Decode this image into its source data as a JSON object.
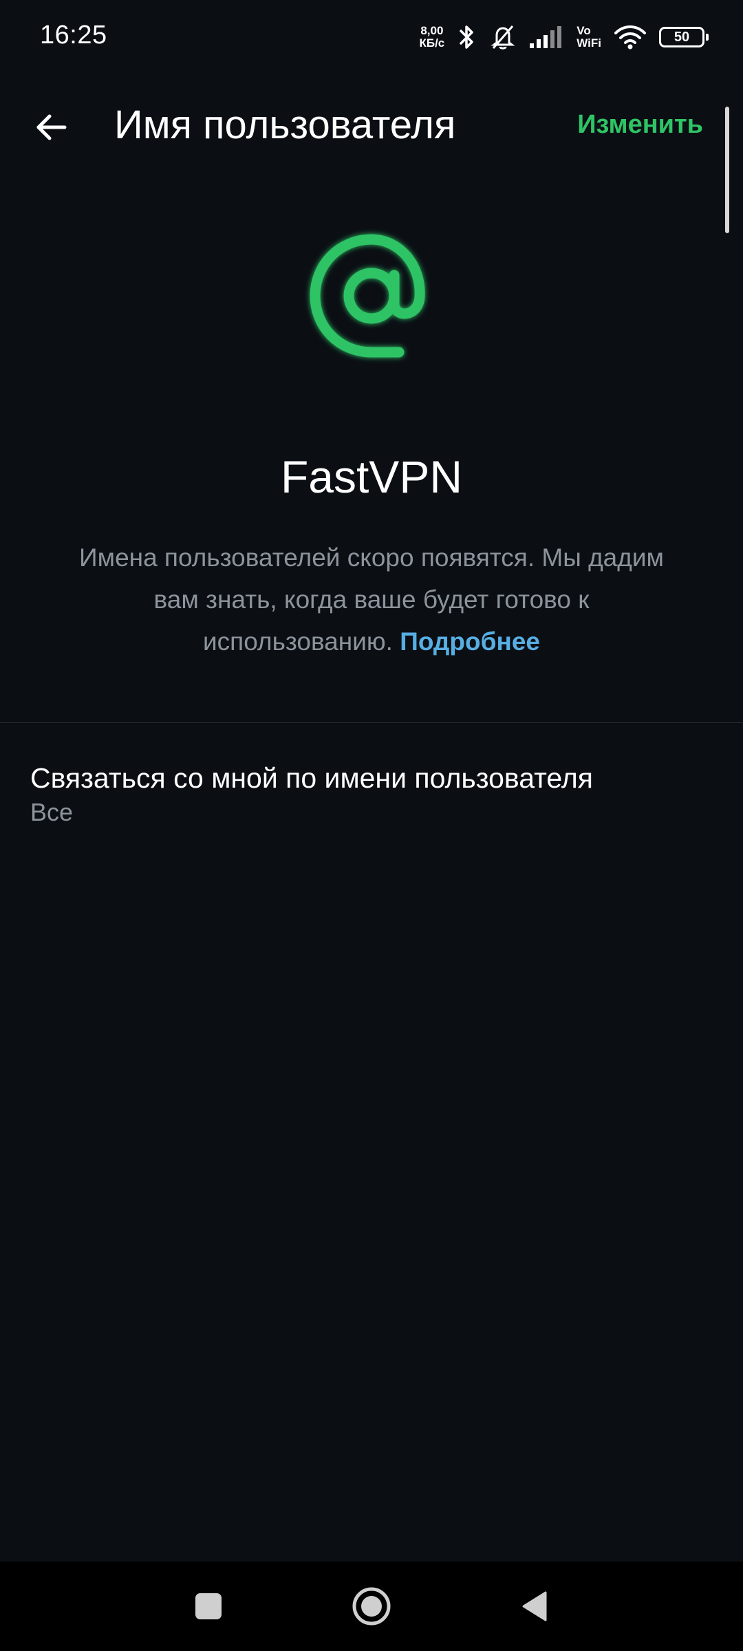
{
  "status_bar": {
    "time": "16:25",
    "speed_value": "8,00",
    "speed_unit": "КБ/с",
    "vowifi_top": "Vo",
    "vowifi_bottom": "WiFi",
    "battery": "50"
  },
  "app_bar": {
    "title": "Имя пользователя",
    "edit_label": "Изменить"
  },
  "hero": {
    "username": "FastVPN",
    "description": "Имена пользователей скоро появятся. Мы дадим вам знать, когда ваше будет готово к использованию.",
    "learn_more": "Подробнее"
  },
  "setting": {
    "title": "Связаться со мной по имени пользователя",
    "value": "Все"
  },
  "colors": {
    "background": "#0b0f14",
    "accent_green": "#2fc466",
    "link_blue": "#57aee3",
    "secondary_text": "#8c939b"
  },
  "icons": {
    "back": "arrow-left-icon",
    "hero": "at-sign-icon",
    "nav_recent": "square-icon",
    "nav_home": "circle-icon",
    "nav_back": "triangle-left-icon"
  }
}
